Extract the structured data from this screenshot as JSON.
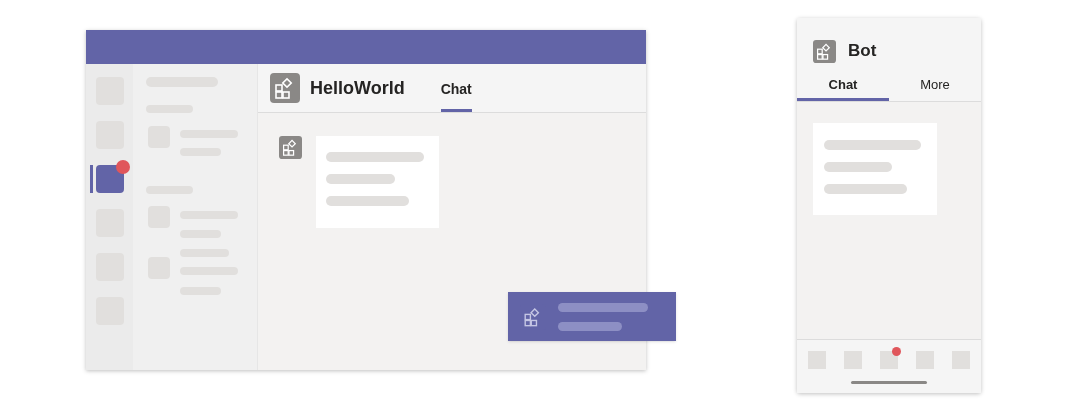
{
  "desktop": {
    "rail": [
      {
        "selected": false,
        "badge": false
      },
      {
        "selected": false,
        "badge": false
      },
      {
        "selected": true,
        "badge": true
      },
      {
        "selected": false,
        "badge": false
      },
      {
        "selected": false,
        "badge": false
      },
      {
        "selected": false,
        "badge": false
      }
    ],
    "app_title": "HelloWorld",
    "tabs": [
      {
        "label": "Chat",
        "selected": true
      }
    ]
  },
  "mobile": {
    "app_title": "Bot",
    "tabs": [
      {
        "label": "Chat",
        "selected": true
      },
      {
        "label": "More",
        "selected": false
      }
    ],
    "nav": [
      {
        "badge": false
      },
      {
        "badge": false
      },
      {
        "badge": true
      },
      {
        "badge": false
      },
      {
        "badge": false
      }
    ]
  }
}
